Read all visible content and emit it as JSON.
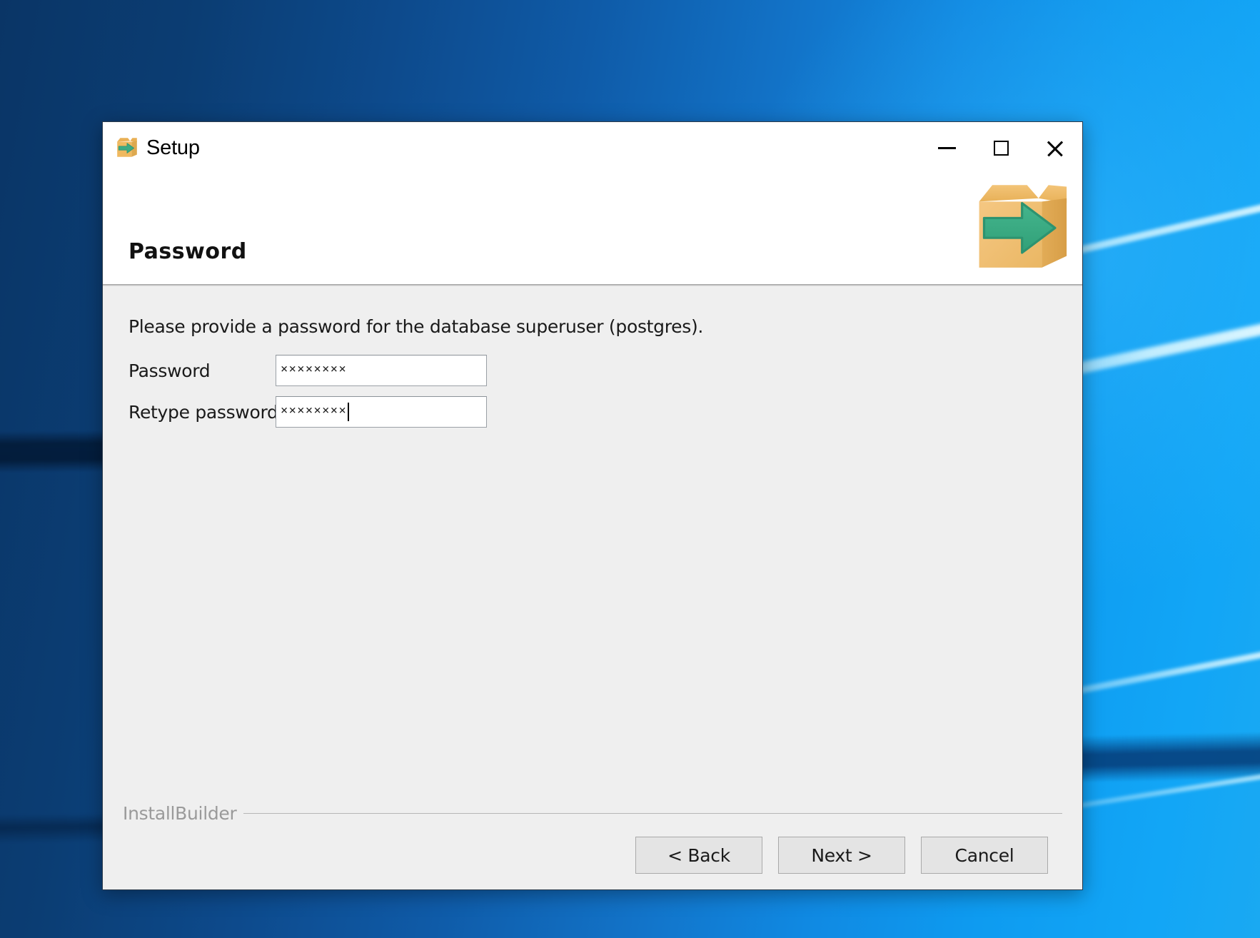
{
  "window": {
    "title": "Setup",
    "title_icon": "installbuilder-box-arrow-icon",
    "controls": {
      "minimize": "minimize-icon",
      "maximize": "maximize-icon",
      "close": "close-icon"
    }
  },
  "header": {
    "heading": "Password",
    "logo": "installbuilder-box-arrow-logo"
  },
  "body": {
    "intro": "Please provide a password for the database superuser (postgres).",
    "fields": [
      {
        "label": "Password",
        "value": "××××××××",
        "placeholder": "",
        "masked_length": 8,
        "focused": false
      },
      {
        "label": "Retype password",
        "value": "××××××××",
        "placeholder": "",
        "masked_length": 8,
        "focused": true
      }
    ]
  },
  "footer": {
    "brand": "InstallBuilder",
    "buttons": [
      {
        "label": "< Back",
        "name": "back-button"
      },
      {
        "label": "Next >",
        "name": "next-button"
      },
      {
        "label": "Cancel",
        "name": "cancel-button"
      }
    ]
  },
  "colors": {
    "dialog_body": "#efefef",
    "dialog_header": "#ffffff",
    "accent_box": "#edb55c",
    "accent_arrow": "#3bab84",
    "desktop_dark_blue": "#0a3566",
    "desktop_light_blue": "#12a6f6"
  }
}
